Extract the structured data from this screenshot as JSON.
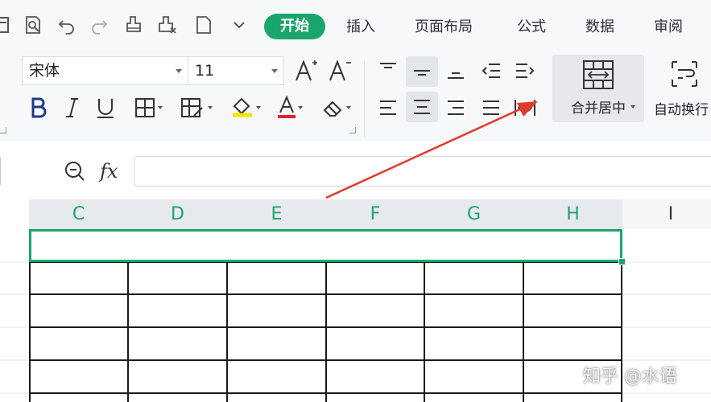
{
  "menu": {
    "tabs": [
      {
        "id": "start",
        "label": "开始",
        "active": true
      },
      {
        "id": "insert",
        "label": "插入"
      },
      {
        "id": "layout",
        "label": "页面布局"
      },
      {
        "id": "formula",
        "label": "公式"
      },
      {
        "id": "data",
        "label": "数据"
      },
      {
        "id": "review",
        "label": "审阅"
      }
    ]
  },
  "quick_access": [
    "preview-icon",
    "undo-icon",
    "redo-icon",
    "format-painter-icon",
    "clear-format-icon",
    "new-document-icon",
    "more-dropdown-icon"
  ],
  "ribbon": {
    "font_name": "宋体",
    "font_size": "11",
    "merge_label": "合并居中",
    "wrap_label": "自动换行",
    "font_color": "#e0262d",
    "highlight_color": "#f2e600"
  },
  "formula_bar": {
    "fx": "fx",
    "value": ""
  },
  "sheet": {
    "columns": [
      "C",
      "D",
      "E",
      "F",
      "G",
      "H",
      "I"
    ],
    "selected_columns": [
      "C",
      "D",
      "E",
      "F",
      "G",
      "H"
    ]
  },
  "accent_color": "#1aa66a",
  "annotation_arrow_color": "#e03a2f",
  "watermark": "知乎 @水语"
}
